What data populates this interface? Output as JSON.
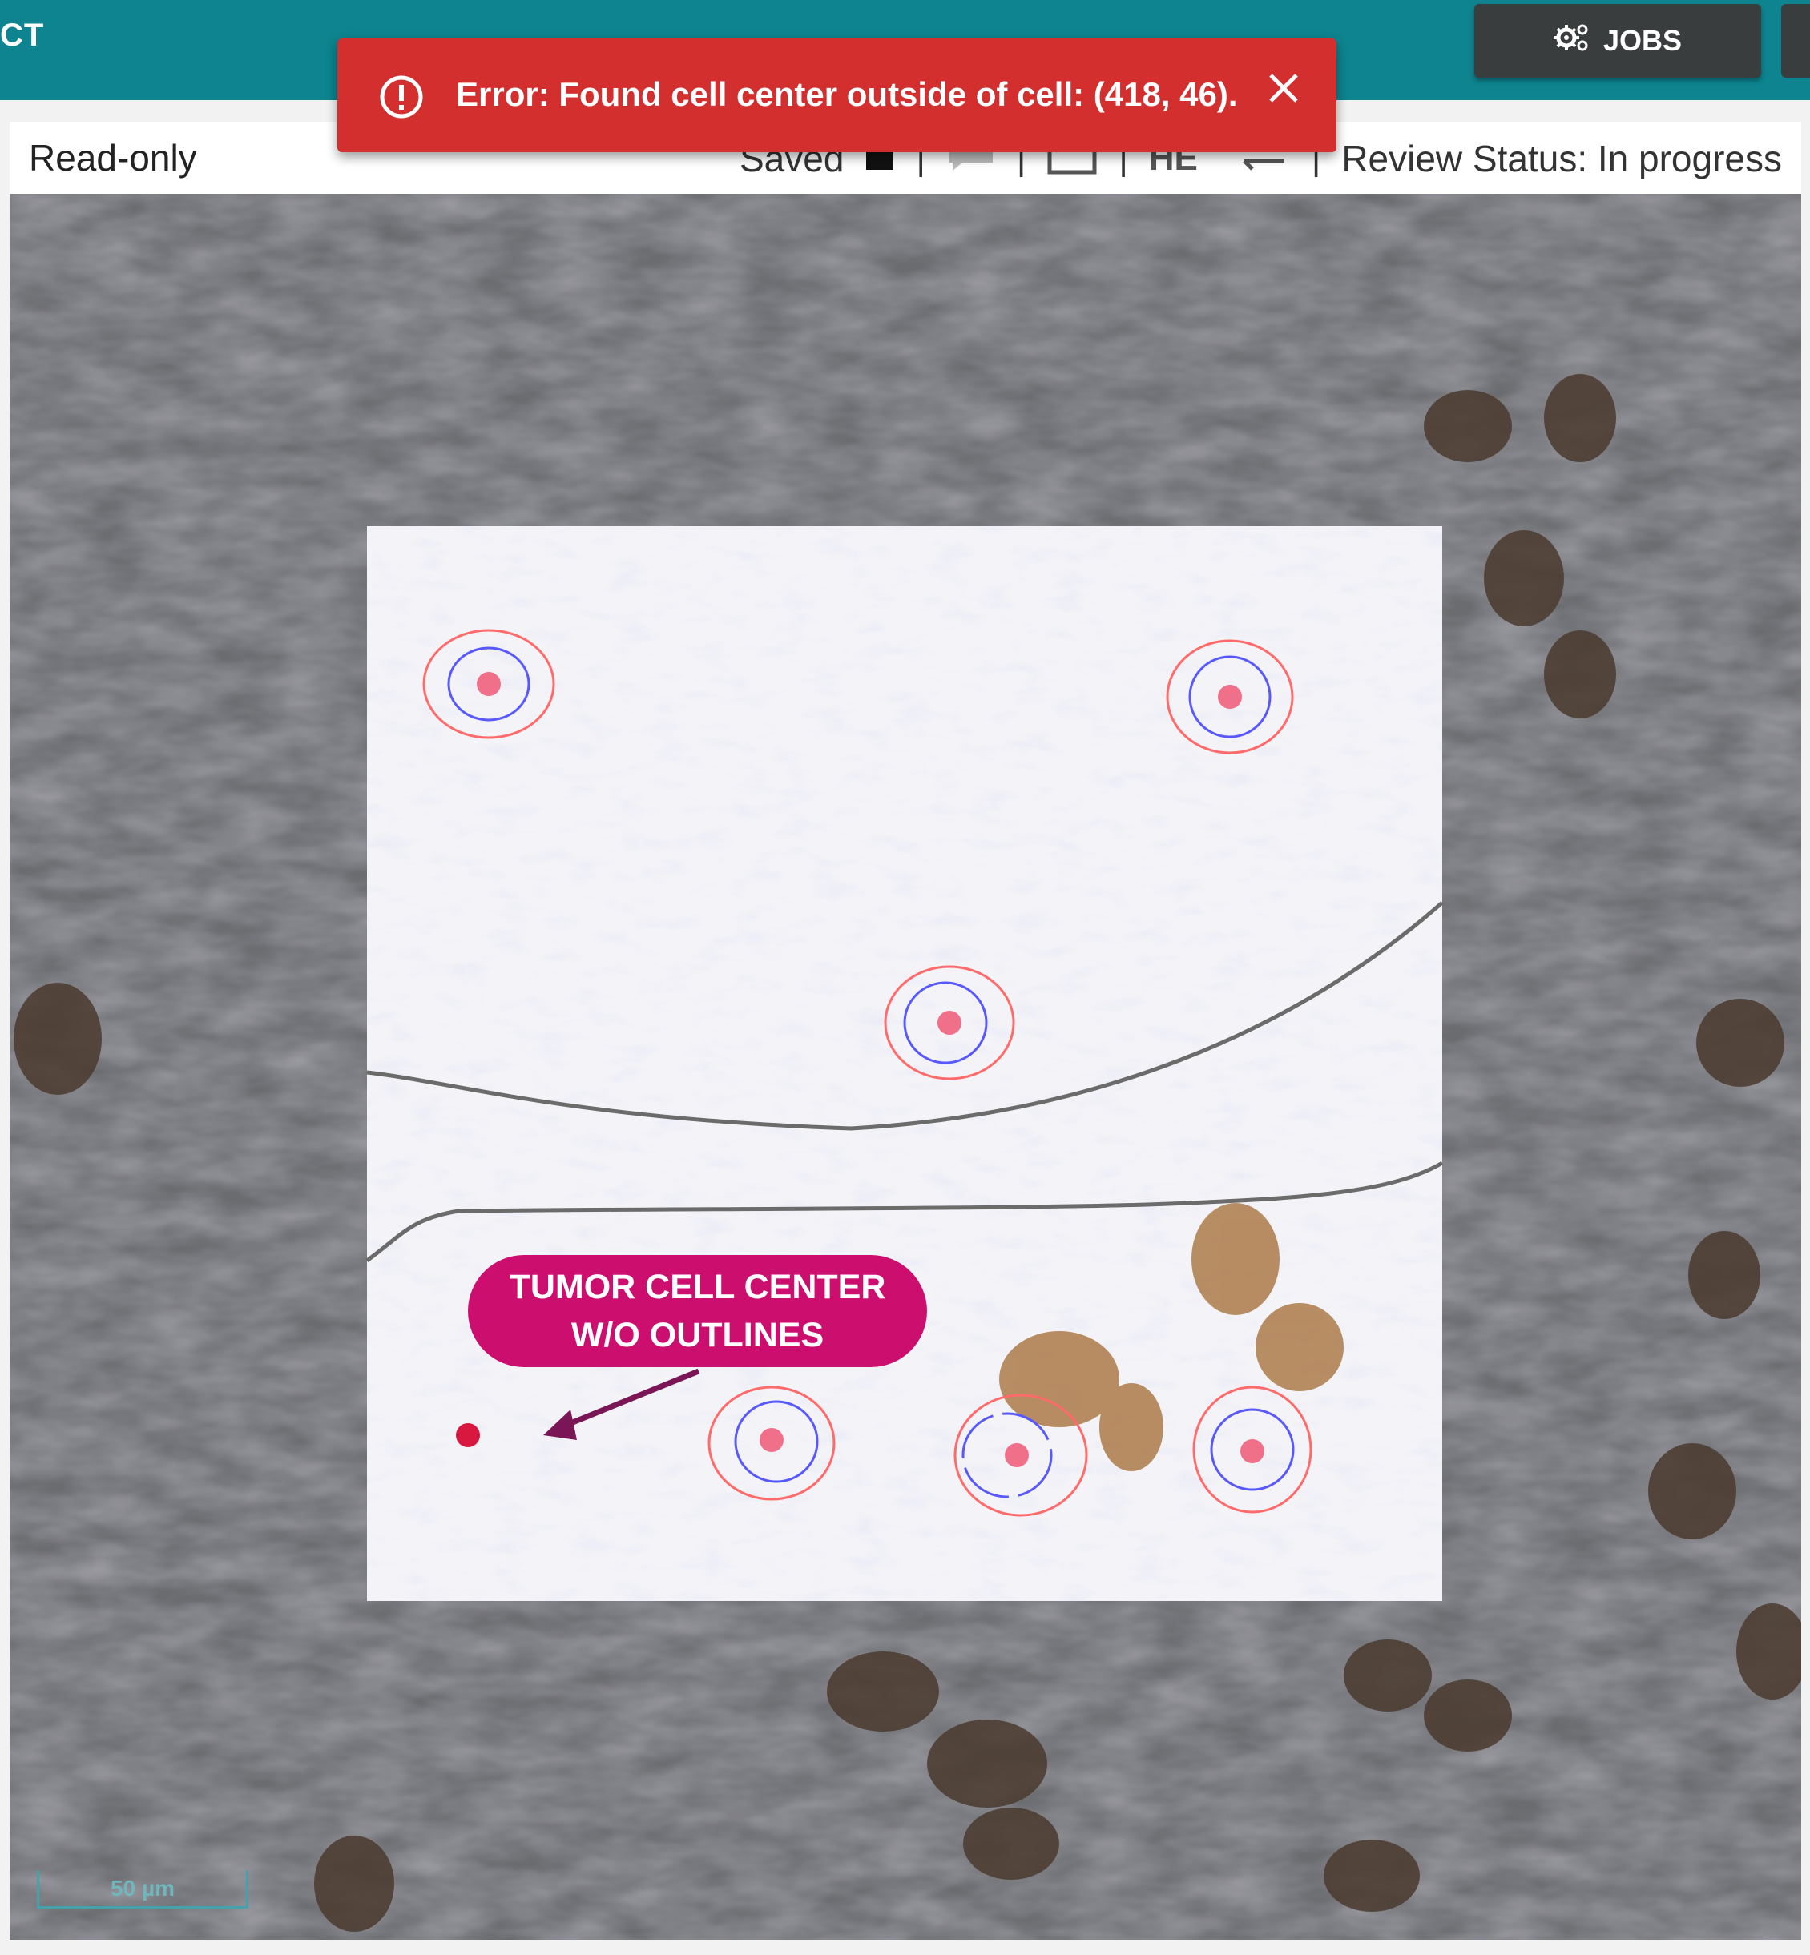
{
  "app": {
    "title": "CT"
  },
  "toolbar": {
    "jobs_label": "JOBS",
    "jobs_icon": "gears-icon"
  },
  "viewer": {
    "mode_label": "Read-only",
    "save_status": "Saved",
    "stain_label": "HE",
    "review_status": "Review Status: In progress"
  },
  "toast": {
    "message": "Error: Found cell center outside of cell: (418, 46).",
    "icon": "error-circle-icon",
    "color": "#d32f2f"
  },
  "annotation": {
    "line1": "TUMOR CELL CENTER",
    "line2": "W/O OUTLINES",
    "color": "#cc0e6f"
  },
  "scale_bar": {
    "label": "50 µm"
  },
  "colors": {
    "topbar": "#0d848f",
    "cell_outline": "#ff5a5a",
    "nucleus_outline": "#4b4bff",
    "center_marker": "#f06a86"
  }
}
